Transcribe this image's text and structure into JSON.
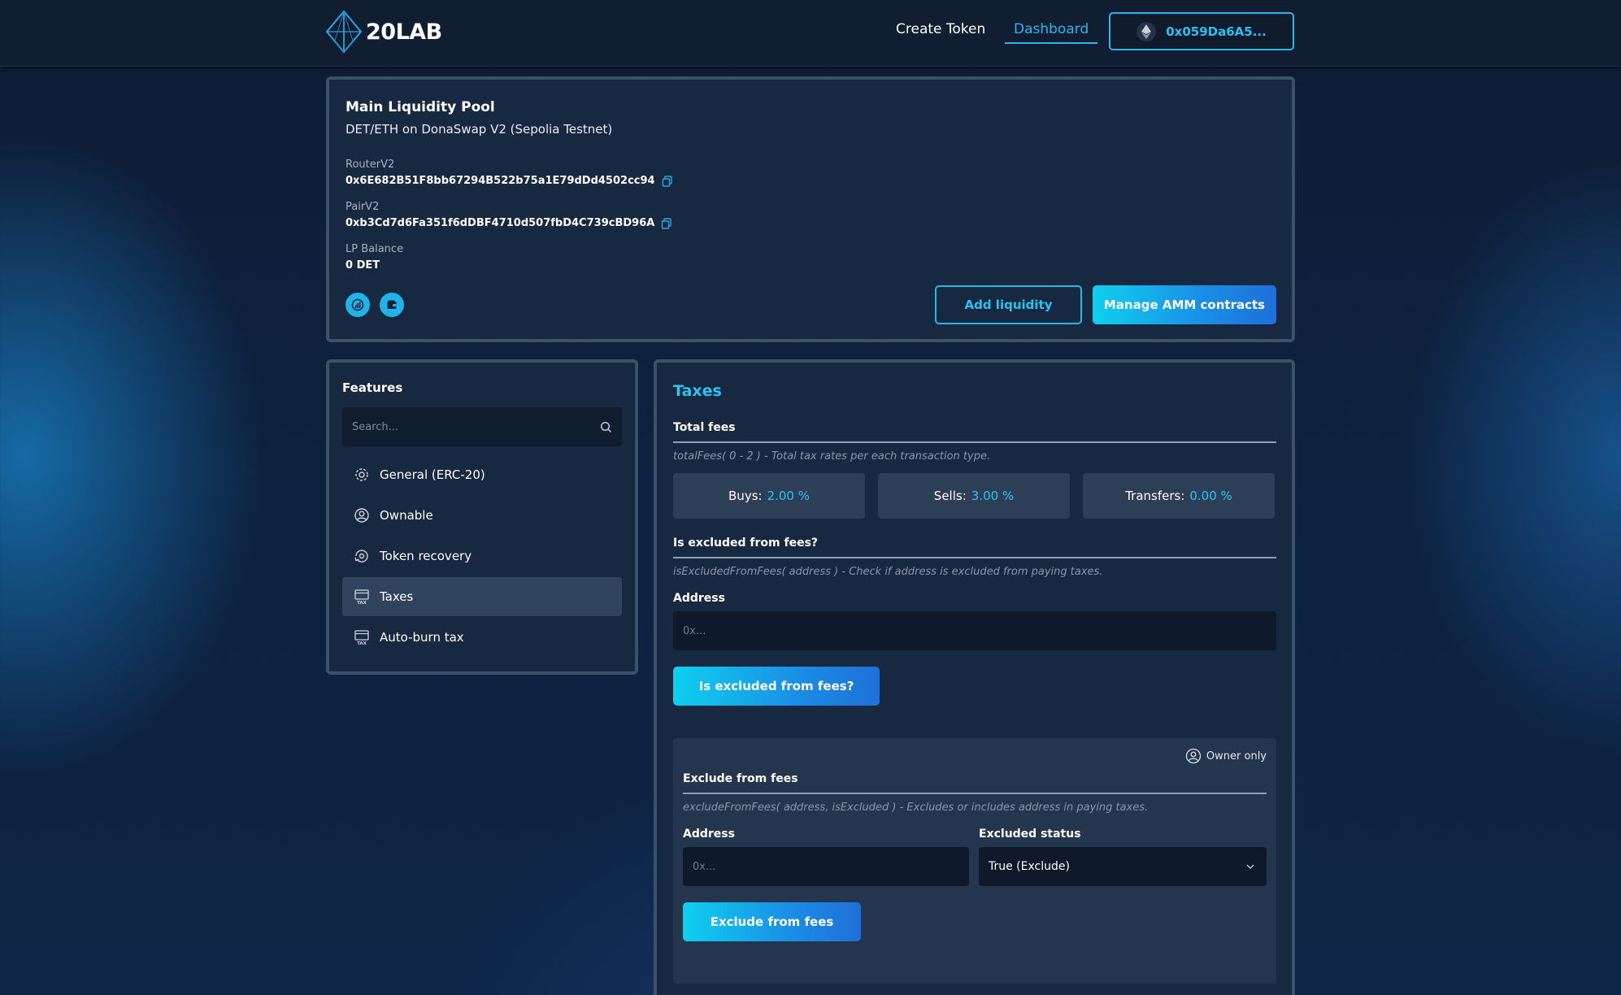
{
  "header": {
    "logo_text": "20LAB",
    "nav": {
      "create_token": "Create Token",
      "dashboard": "Dashboard"
    },
    "wallet_address": "0x059Da6A5..."
  },
  "pool": {
    "title": "Main Liquidity Pool",
    "subtitle": "DET/ETH on DonaSwap V2 (Sepolia Testnet)",
    "router_label": "RouterV2",
    "router_value": "0x6E682B51F8bb67294B522b75a1E79dDd4502cc94",
    "pair_label": "PairV2",
    "pair_value": "0xb3Cd7d6Fa351f6dDBF4710d507fbD4C739cBD96A",
    "lp_label": "LP Balance",
    "lp_value": "0 DET",
    "add_liquidity": "Add liquidity",
    "manage_amm": "Manage AMM contracts"
  },
  "features": {
    "title": "Features",
    "search_placeholder": "Search...",
    "items": [
      {
        "label": "General (ERC-20)",
        "icon": "gear-icon"
      },
      {
        "label": "Ownable",
        "icon": "user-circle-icon"
      },
      {
        "label": "Token recovery",
        "icon": "recovery-icon"
      },
      {
        "label": "Taxes",
        "icon": "tax-icon",
        "active": true
      },
      {
        "label": "Auto-burn tax",
        "icon": "tax-icon"
      }
    ]
  },
  "taxes": {
    "title": "Taxes",
    "total_fees": {
      "title": "Total fees",
      "desc": "totalFees( 0 - 2 ) - Total tax rates per each transaction type.",
      "buys_label": "Buys:",
      "buys_value": "2.00 %",
      "sells_label": "Sells:",
      "sells_value": "3.00 %",
      "transfers_label": "Transfers:",
      "transfers_value": "0.00 %"
    },
    "is_excluded": {
      "title": "Is excluded from fees?",
      "desc": "isExcludedFromFees( address ) - Check if address is excluded from paying taxes.",
      "address_label": "Address",
      "address_placeholder": "0x...",
      "button": "Is excluded from fees?"
    },
    "exclude": {
      "owner_only": "Owner only",
      "title": "Exclude from fees",
      "desc": "excludeFromFees( address, isExcluded ) - Excludes or includes address in paying taxes.",
      "address_label": "Address",
      "address_placeholder": "0x...",
      "status_label": "Excluded status",
      "status_value": "True (Exclude)",
      "button": "Exclude from fees"
    }
  }
}
